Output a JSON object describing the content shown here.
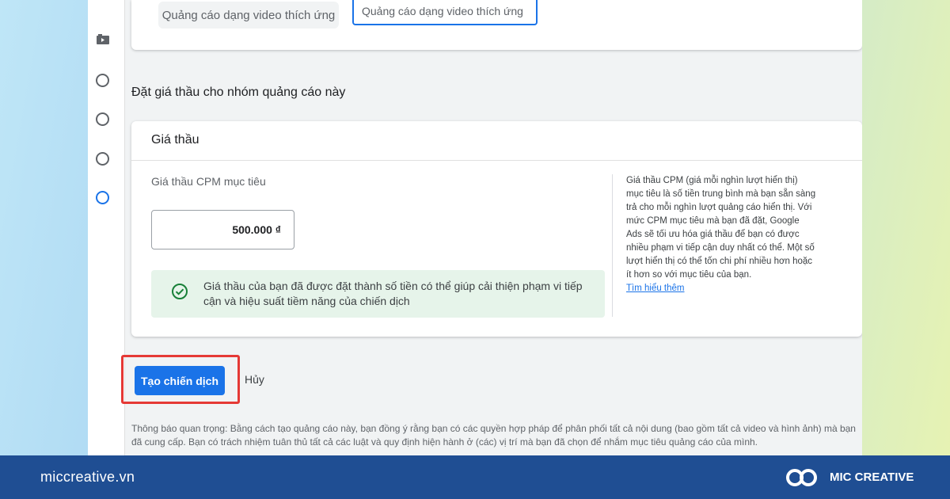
{
  "top_card": {
    "chip_label": "Quảng cáo dạng video thích ứng",
    "input_value": "Quảng cáo dạng video thích ứng"
  },
  "section": {
    "title": "Đặt giá thầu cho nhóm quảng cáo này"
  },
  "bid_card": {
    "header": "Giá thầu",
    "cpm_label": "Giá thầu CPM mục tiêu",
    "cpm_value": "500.000 ₫",
    "notice_text": "Giá thầu của bạn đã được đặt thành số tiền có thể giúp cải thiện phạm vi tiếp cận và hiệu suất tiềm năng của chiến dịch",
    "help_text": "Giá thầu CPM (giá mỗi nghìn lượt hiển thị) mục tiêu là số tiền trung bình mà bạn sẵn sàng trả cho mỗi nghìn lượt quảng cáo hiển thị. Với mức CPM mục tiêu mà bạn đã đặt, Google Ads sẽ tối ưu hóa giá thầu để bạn có được nhiều phạm vi tiếp cận duy nhất có thể. Một số lượt hiển thị có thể tốn chi phí nhiều hơn hoặc ít hơn so với mục tiêu của bạn.",
    "help_link": "Tìm hiểu thêm"
  },
  "actions": {
    "create_label": "Tạo chiến dịch",
    "cancel_label": "Hủy"
  },
  "legal_text": "Thông báo quan trọng: Bằng cách tạo quảng cáo này, bạn đồng ý rằng bạn có các quyền hợp pháp để phân phối tất cả nội dung (bao gồm tất cả video và hình ảnh) mà bạn đã cung cấp. Bạn có trách nhiệm tuân thủ tất cả các luật và quy định hiện hành ở (các) vị trí mà bạn đã chọn để nhắm mục tiêu quảng cáo của mình.",
  "footer": {
    "site": "miccreative.vn",
    "brand": "MIC CREATIVE"
  },
  "colors": {
    "primary": "#1a73e8",
    "highlight": "#e53935",
    "success_bg": "#e6f4ea",
    "success_icon": "#188038",
    "footer_bg": "#1f4e93"
  }
}
